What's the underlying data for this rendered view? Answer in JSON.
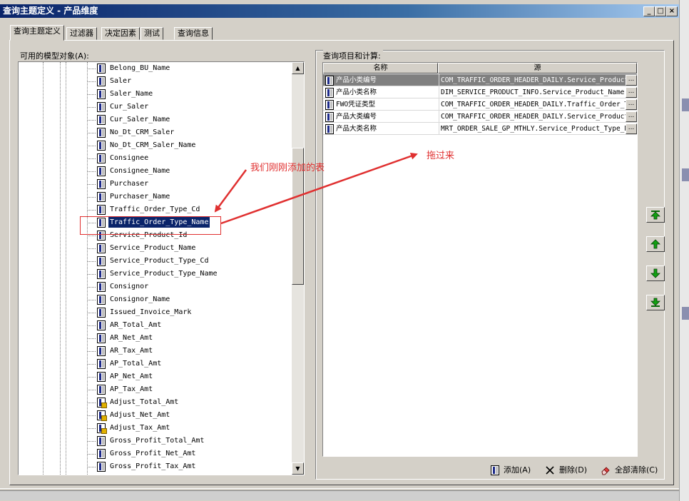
{
  "window": {
    "title": "查询主题定义 - 产品维度",
    "min_glyph": "_",
    "max_glyph": "□",
    "close_glyph": "×"
  },
  "tabs": [
    {
      "label": "查询主题定义",
      "active": true
    },
    {
      "label": "过滤器",
      "active": false
    },
    {
      "label": "决定因素",
      "active": false
    },
    {
      "label": "测试",
      "active": false
    },
    {
      "label": "查询信息",
      "active": false
    }
  ],
  "left_panel": {
    "label": "可用的模型对象(A):",
    "items": [
      {
        "name": "Belong_BU_Name",
        "icon": "column-icon"
      },
      {
        "name": "Saler",
        "icon": "column-icon"
      },
      {
        "name": "Saler_Name",
        "icon": "column-icon"
      },
      {
        "name": "Cur_Saler",
        "icon": "column-icon"
      },
      {
        "name": "Cur_Saler_Name",
        "icon": "column-icon"
      },
      {
        "name": "No_Dt_CRM_Saler",
        "icon": "column-icon"
      },
      {
        "name": "No_Dt_CRM_Saler_Name",
        "icon": "column-icon"
      },
      {
        "name": "Consignee",
        "icon": "column-icon"
      },
      {
        "name": "Consignee_Name",
        "icon": "column-icon"
      },
      {
        "name": "Purchaser",
        "icon": "column-icon"
      },
      {
        "name": "Purchaser_Name",
        "icon": "column-icon"
      },
      {
        "name": "Traffic_Order_Type_Cd",
        "icon": "column-icon"
      },
      {
        "name": "Traffic_Order_Type_Name",
        "icon": "column-icon",
        "selected": true
      },
      {
        "name": "Service_Product_Id",
        "icon": "column-icon"
      },
      {
        "name": "Service_Product_Name",
        "icon": "column-icon"
      },
      {
        "name": "Service_Product_Type_Cd",
        "icon": "column-icon"
      },
      {
        "name": "Service_Product_Type_Name",
        "icon": "column-icon"
      },
      {
        "name": "Consignor",
        "icon": "column-icon"
      },
      {
        "name": "Consignor_Name",
        "icon": "column-icon"
      },
      {
        "name": "Issued_Invoice_Mark",
        "icon": "column-icon"
      },
      {
        "name": "AR_Total_Amt",
        "icon": "column-icon"
      },
      {
        "name": "AR_Net_Amt",
        "icon": "column-icon"
      },
      {
        "name": "AR_Tax_Amt",
        "icon": "column-icon"
      },
      {
        "name": "AP_Total_Amt",
        "icon": "column-icon"
      },
      {
        "name": "AP_Net_Amt",
        "icon": "column-icon"
      },
      {
        "name": "AP_Tax_Amt",
        "icon": "column-icon"
      },
      {
        "name": "Adjust_Total_Amt",
        "icon": "measure-icon"
      },
      {
        "name": "Adjust_Net_Amt",
        "icon": "measure-icon"
      },
      {
        "name": "Adjust_Tax_Amt",
        "icon": "measure-icon"
      },
      {
        "name": "Gross_Profit_Total_Amt",
        "icon": "column-icon"
      },
      {
        "name": "Gross_Profit_Net_Amt",
        "icon": "column-icon"
      },
      {
        "name": "Gross_Profit_Tax_Amt",
        "icon": "column-icon"
      }
    ]
  },
  "right_panel": {
    "label": "查询项目和计算:",
    "columns": [
      "名称",
      "源"
    ],
    "rows": [
      {
        "name": "产品小类编号",
        "source": "COM_TRAFFIC_ORDER_HEADER_DAILY.Service_Product_Id",
        "selected": true
      },
      {
        "name": "产品小类名称",
        "source": "DIM_SERVICE_PRODUCT_INFO.Service_Product_Name"
      },
      {
        "name": "FWO凭证类型",
        "source": "COM_TRAFFIC_ORDER_HEADER_DAILY.Traffic_Order_Type_Cd"
      },
      {
        "name": "产品大类编号",
        "source": "COM_TRAFFIC_ORDER_HEADER_DAILY.Service_Product_Type_Cd"
      },
      {
        "name": "产品大类名称",
        "source": "MRT_ORDER_SALE_GP_MTHLY.Service_Product_Type_Name"
      }
    ],
    "ellipsis": "..."
  },
  "actions": {
    "add": "添加(A)",
    "delete": "删除(D)",
    "clear_all": "全部清除(C)"
  },
  "annotations": {
    "just_added": "我们刚刚添加的表",
    "drag_here": "拖过来"
  },
  "colors": {
    "titlebar": "#0a246a",
    "selection": "#0a246a",
    "annotation": "#e03030",
    "arrow_green": "#0a8a0a"
  }
}
